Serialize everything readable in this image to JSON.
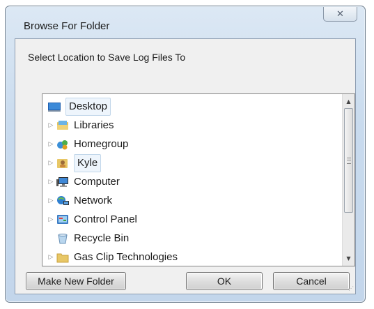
{
  "window": {
    "title": "Browse For Folder",
    "close_glyph": "✕"
  },
  "prompt": "Select Location to Save Log Files To",
  "tree": {
    "items": [
      {
        "label": "Desktop",
        "icon": "desktop-icon",
        "expander": "",
        "selected": true
      },
      {
        "label": "Libraries",
        "icon": "libraries-icon",
        "expander": "▷"
      },
      {
        "label": "Homegroup",
        "icon": "homegroup-icon",
        "expander": "▷"
      },
      {
        "label": "Kyle",
        "icon": "user-folder-icon",
        "expander": "▷",
        "highlighted": true
      },
      {
        "label": "Computer",
        "icon": "computer-icon",
        "expander": "▷"
      },
      {
        "label": "Network",
        "icon": "network-icon",
        "expander": "▷"
      },
      {
        "label": "Control Panel",
        "icon": "control-panel-icon",
        "expander": "▷"
      },
      {
        "label": "Recycle Bin",
        "icon": "recycle-bin-icon",
        "expander": ""
      },
      {
        "label": "Gas Clip Technologies",
        "icon": "folder-icon",
        "expander": "▷"
      }
    ]
  },
  "scrollbar": {
    "up_glyph": "▲",
    "down_glyph": "▼"
  },
  "buttons": {
    "make_new_folder": "Make New Folder",
    "ok": "OK",
    "cancel": "Cancel"
  },
  "resize_grip_glyph": "⋰"
}
